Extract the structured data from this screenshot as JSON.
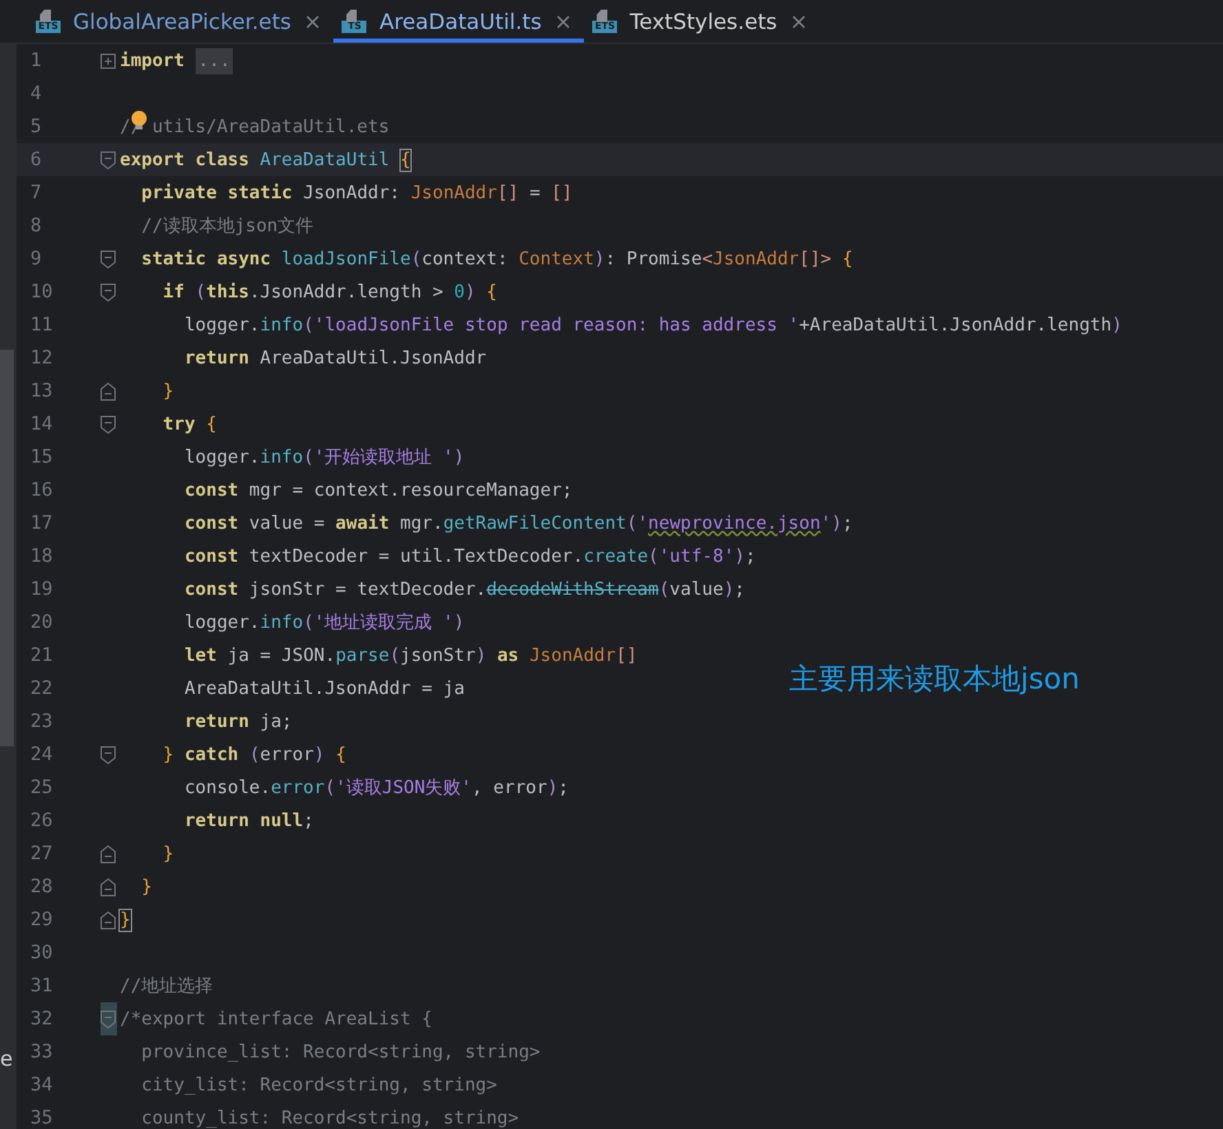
{
  "tabs": [
    {
      "label": "GlobalAreaPicker.ets",
      "icon_label": "ETS",
      "selected": false
    },
    {
      "label": "AreaDataUtil.ts",
      "icon_label": "TS",
      "selected": true
    },
    {
      "label": "TextStyles.ets",
      "icon_label": "ETS",
      "selected": false
    }
  ],
  "left_fragment": "e",
  "lines": [
    {
      "number": "1",
      "kind": "collapsed",
      "current": false,
      "tokens": [
        {
          "kind": "kw",
          "text": "import "
        },
        {
          "kind": "folded",
          "text": "..."
        }
      ]
    },
    {
      "number": "4",
      "kind": "plain",
      "current": false
    },
    {
      "number": "5",
      "kind": "plain",
      "current": false,
      "bulb": true,
      "tokens": [
        {
          "kind": "c",
          "text": "// utils/AreaDataUtil.ets"
        }
      ]
    },
    {
      "number": "6",
      "kind": "start",
      "current": true,
      "tokens": [
        {
          "kind": "kw",
          "text": "export class "
        },
        {
          "kind": "cls",
          "text": "AreaDataUtil "
        },
        {
          "kind": "bm",
          "text": "{"
        }
      ]
    },
    {
      "number": "7",
      "kind": "plain",
      "current": false,
      "tokens": [
        {
          "kind": "kw",
          "text": "  private static "
        },
        {
          "kind": "p",
          "text": "JsonAddr: "
        },
        {
          "kind": "t",
          "text": "JsonAddr"
        },
        {
          "kind": "br",
          "text": "[]"
        },
        {
          "kind": "p",
          "text": " = "
        },
        {
          "kind": "br",
          "text": "[]"
        }
      ]
    },
    {
      "number": "8",
      "kind": "plain",
      "current": false,
      "tokens": [
        {
          "kind": "c",
          "text": "  //读取本地json文件"
        }
      ]
    },
    {
      "number": "9",
      "kind": "start",
      "current": false,
      "tokens": [
        {
          "kind": "kw",
          "text": "  static async "
        },
        {
          "kind": "f",
          "text": "loadJsonFile"
        },
        {
          "kind": "pa",
          "text": "("
        },
        {
          "kind": "p",
          "text": "context: "
        },
        {
          "kind": "t",
          "text": "Context"
        },
        {
          "kind": "pa",
          "text": ")"
        },
        {
          "kind": "p",
          "text": ": Promise"
        },
        {
          "kind": "br",
          "text": "<"
        },
        {
          "kind": "t",
          "text": "JsonAddr"
        },
        {
          "kind": "br",
          "text": "[]> "
        },
        {
          "kind": "b",
          "text": "{"
        }
      ]
    },
    {
      "number": "10",
      "kind": "start",
      "current": false,
      "tokens": [
        {
          "kind": "kw",
          "text": "    if "
        },
        {
          "kind": "pa",
          "text": "("
        },
        {
          "kind": "kw",
          "text": "this"
        },
        {
          "kind": "p",
          "text": ".JsonAddr.length > "
        },
        {
          "kind": "n",
          "text": "0"
        },
        {
          "kind": "pa",
          "text": ") "
        },
        {
          "kind": "b",
          "text": "{"
        }
      ]
    },
    {
      "number": "11",
      "kind": "plain",
      "current": false,
      "tokens": [
        {
          "kind": "p",
          "text": "      logger."
        },
        {
          "kind": "f",
          "text": "info"
        },
        {
          "kind": "pa",
          "text": "("
        },
        {
          "kind": "s",
          "text": "'loadJsonFile stop read reason: has address '"
        },
        {
          "kind": "p",
          "text": "+AreaDataUtil.JsonAddr.length"
        },
        {
          "kind": "pa",
          "text": ")"
        }
      ]
    },
    {
      "number": "12",
      "kind": "plain",
      "current": false,
      "tokens": [
        {
          "kind": "kw",
          "text": "      return "
        },
        {
          "kind": "p",
          "text": "AreaDataUtil.JsonAddr"
        }
      ]
    },
    {
      "number": "13",
      "kind": "end",
      "current": false,
      "tokens": [
        {
          "kind": "b",
          "text": "    }"
        }
      ]
    },
    {
      "number": "14",
      "kind": "start",
      "current": false,
      "tokens": [
        {
          "kind": "kw",
          "text": "    try "
        },
        {
          "kind": "b",
          "text": "{"
        }
      ]
    },
    {
      "number": "15",
      "kind": "plain",
      "current": false,
      "tokens": [
        {
          "kind": "p",
          "text": "      logger."
        },
        {
          "kind": "f",
          "text": "info"
        },
        {
          "kind": "pa",
          "text": "("
        },
        {
          "kind": "s",
          "text": "'开始读取地址 '"
        },
        {
          "kind": "pa",
          "text": ")"
        }
      ]
    },
    {
      "number": "16",
      "kind": "plain",
      "current": false,
      "tokens": [
        {
          "kind": "kw",
          "text": "      const "
        },
        {
          "kind": "p",
          "text": "mgr = context.resourceManager;"
        }
      ]
    },
    {
      "number": "17",
      "kind": "plain",
      "current": false,
      "tokens": [
        {
          "kind": "kw",
          "text": "      const "
        },
        {
          "kind": "p",
          "text": "value = "
        },
        {
          "kind": "kw",
          "text": "await "
        },
        {
          "kind": "p",
          "text": "mgr."
        },
        {
          "kind": "f",
          "text": "getRawFileContent"
        },
        {
          "kind": "pa",
          "text": "("
        },
        {
          "kind": "s",
          "text": "'"
        },
        {
          "kind": "u",
          "text": "newprovince.json"
        },
        {
          "kind": "s",
          "text": "'"
        },
        {
          "kind": "pa",
          "text": ")"
        },
        {
          "kind": "p",
          "text": ";"
        }
      ]
    },
    {
      "number": "18",
      "kind": "plain",
      "current": false,
      "tokens": [
        {
          "kind": "kw",
          "text": "      const "
        },
        {
          "kind": "p",
          "text": "textDecoder = util.TextDecoder."
        },
        {
          "kind": "f",
          "text": "create"
        },
        {
          "kind": "pa",
          "text": "("
        },
        {
          "kind": "s",
          "text": "'utf-8'"
        },
        {
          "kind": "pa",
          "text": ")"
        },
        {
          "kind": "p",
          "text": ";"
        }
      ]
    },
    {
      "number": "19",
      "kind": "plain",
      "current": false,
      "tokens": [
        {
          "kind": "kw",
          "text": "      const "
        },
        {
          "kind": "p",
          "text": "jsonStr = textDecoder."
        },
        {
          "kind": "d",
          "text": "decodeWithStream"
        },
        {
          "kind": "pa",
          "text": "("
        },
        {
          "kind": "p",
          "text": "value"
        },
        {
          "kind": "pa",
          "text": ")"
        },
        {
          "kind": "p",
          "text": ";"
        }
      ]
    },
    {
      "number": "20",
      "kind": "plain",
      "current": false,
      "tokens": [
        {
          "kind": "p",
          "text": "      logger."
        },
        {
          "kind": "f",
          "text": "info"
        },
        {
          "kind": "pa",
          "text": "("
        },
        {
          "kind": "s",
          "text": "'地址读取完成 '"
        },
        {
          "kind": "pa",
          "text": ")"
        }
      ]
    },
    {
      "number": "21",
      "kind": "plain",
      "current": false,
      "tokens": [
        {
          "kind": "kw",
          "text": "      let "
        },
        {
          "kind": "p",
          "text": "ja = JSON."
        },
        {
          "kind": "f",
          "text": "parse"
        },
        {
          "kind": "pa",
          "text": "("
        },
        {
          "kind": "p",
          "text": "jsonStr"
        },
        {
          "kind": "pa",
          "text": ")"
        },
        {
          "kind": "kw",
          "text": " as "
        },
        {
          "kind": "t",
          "text": "JsonAddr"
        },
        {
          "kind": "br",
          "text": "[]"
        }
      ]
    },
    {
      "number": "22",
      "kind": "plain",
      "current": false,
      "tokens": [
        {
          "kind": "p",
          "text": "      AreaDataUtil.JsonAddr = ja"
        }
      ]
    },
    {
      "number": "23",
      "kind": "plain",
      "current": false,
      "tokens": [
        {
          "kind": "kw",
          "text": "      return "
        },
        {
          "kind": "p",
          "text": "ja;"
        }
      ]
    },
    {
      "number": "24",
      "kind": "start",
      "current": false,
      "tokens": [
        {
          "kind": "b",
          "text": "    } "
        },
        {
          "kind": "kw",
          "text": "catch "
        },
        {
          "kind": "pa",
          "text": "("
        },
        {
          "kind": "p",
          "text": "error"
        },
        {
          "kind": "pa",
          "text": ") "
        },
        {
          "kind": "b",
          "text": "{"
        }
      ]
    },
    {
      "number": "25",
      "kind": "plain",
      "current": false,
      "tokens": [
        {
          "kind": "p",
          "text": "      console."
        },
        {
          "kind": "f",
          "text": "error"
        },
        {
          "kind": "pa",
          "text": "("
        },
        {
          "kind": "s",
          "text": "'读取JSON失败'"
        },
        {
          "kind": "p",
          "text": ", error"
        },
        {
          "kind": "pa",
          "text": ")"
        },
        {
          "kind": "p",
          "text": ";"
        }
      ]
    },
    {
      "number": "26",
      "kind": "plain",
      "current": false,
      "tokens": [
        {
          "kind": "kw",
          "text": "      return null"
        },
        {
          "kind": "p",
          "text": ";"
        }
      ]
    },
    {
      "number": "27",
      "kind": "end",
      "current": false,
      "tokens": [
        {
          "kind": "b",
          "text": "    }"
        }
      ]
    },
    {
      "number": "28",
      "kind": "end",
      "current": false,
      "tokens": [
        {
          "kind": "b",
          "text": "  }"
        }
      ]
    },
    {
      "number": "29",
      "kind": "end",
      "current": false,
      "tokens": [
        {
          "kind": "bm",
          "text": "}"
        }
      ]
    },
    {
      "number": "30",
      "kind": "plain",
      "current": false
    },
    {
      "number": "31",
      "kind": "plain",
      "current": false,
      "tokens": [
        {
          "kind": "c",
          "text": "//地址选择"
        }
      ]
    },
    {
      "number": "32",
      "kind": "start",
      "current": false,
      "fold_highlight": true,
      "tokens": [
        {
          "kind": "c",
          "text": "/*export interface AreaList {"
        }
      ]
    },
    {
      "number": "33",
      "kind": "plain",
      "current": false,
      "tokens": [
        {
          "kind": "c",
          "text": "  province_list: Record<string, string>"
        }
      ]
    },
    {
      "number": "34",
      "kind": "plain",
      "current": false,
      "tokens": [
        {
          "kind": "c",
          "text": "  city_list: Record<string, string>"
        }
      ]
    },
    {
      "number": "35",
      "kind": "plain",
      "current": false,
      "tokens": [
        {
          "kind": "c",
          "text": "  county_list: Record<string, string>"
        }
      ]
    }
  ],
  "annotation": "主要用来读取本地json"
}
